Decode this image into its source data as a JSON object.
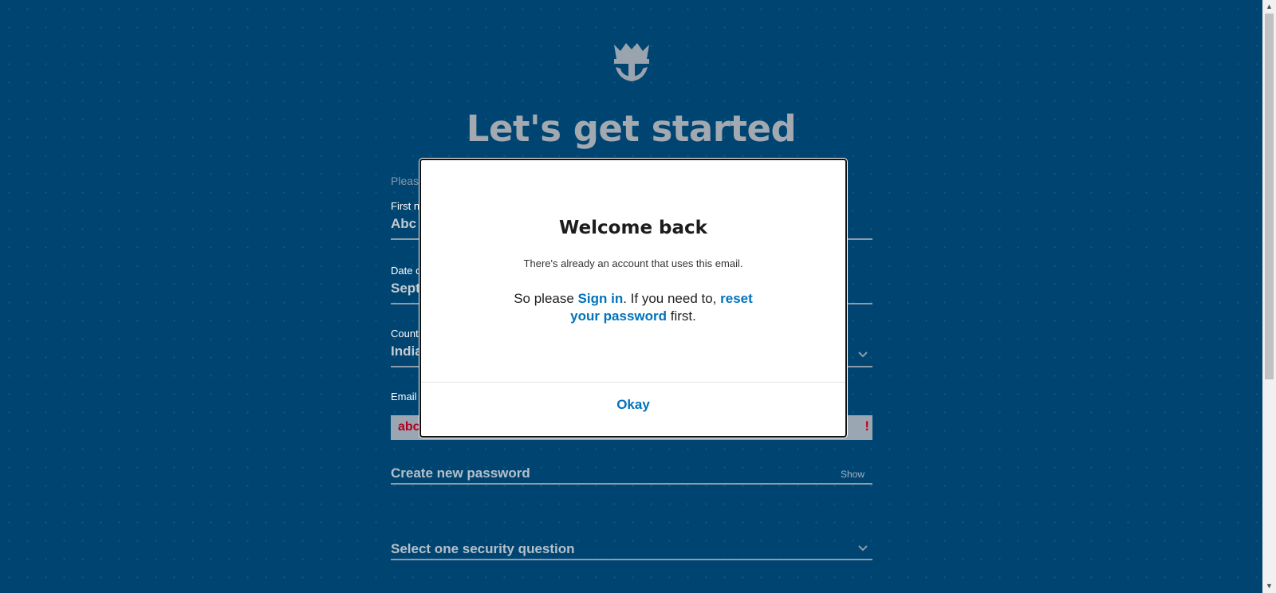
{
  "page": {
    "title": "Let's get started",
    "intro": "Pleas"
  },
  "form": {
    "first_name_label": "First n",
    "first_name_value": "Abc",
    "dob_label": "Date o",
    "dob_value": "Sept",
    "country_label": "Count",
    "country_value": "India",
    "email_label": "Email",
    "email_value": "abc",
    "email_error_icon": "!",
    "password_placeholder": "Create new password",
    "password_show_label": "Show",
    "security_question_placeholder": "Select one security question"
  },
  "modal": {
    "title": "Welcome back",
    "subtitle": "There's already an account that uses this email.",
    "body_prefix": "So please ",
    "sign_in_link": "Sign in",
    "body_middle": ". If you need to, ",
    "reset_link": "reset your password",
    "body_suffix": " first.",
    "okay_button": "Okay"
  },
  "icons": {
    "logo": "crown-anchor-logo-icon",
    "chevron": "chevron-down-icon",
    "scroll_up": "scroll-up-arrow-icon",
    "scroll_down": "scroll-down-arrow-icon"
  },
  "colors": {
    "background": "#004471",
    "link": "#0073bb",
    "error": "#c8001b"
  }
}
